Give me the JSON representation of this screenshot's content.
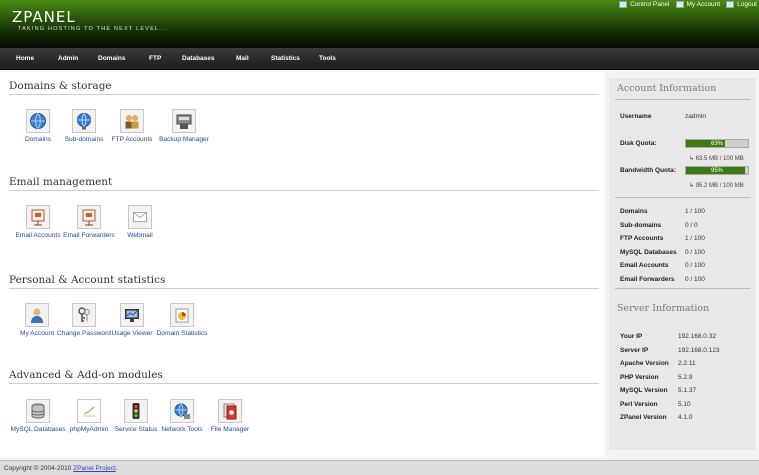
{
  "header": {
    "logo": "ZPANEL",
    "tagline": "TAKING HOSTING TO THE NEXT LEVEL...",
    "links": [
      {
        "label": "Control Panel",
        "icon": "control-panel-icon"
      },
      {
        "label": "My Account",
        "icon": "account-icon"
      },
      {
        "label": "Logout",
        "icon": "logout-icon"
      }
    ]
  },
  "nav": {
    "items": [
      "Home",
      "Admin",
      "Domains",
      "FTP",
      "Databases",
      "Mail",
      "Statistics",
      "Tools"
    ]
  },
  "sections": [
    {
      "title": "Domains & storage",
      "modules": [
        {
          "label": "Domains",
          "icon": "globe-icon"
        },
        {
          "label": "Sub-domains",
          "icon": "globe-icon"
        },
        {
          "label": "FTP Accounts",
          "icon": "users-icon"
        },
        {
          "label": "Backup Manager",
          "icon": "backup-icon"
        }
      ]
    },
    {
      "title": "Email management",
      "modules": [
        {
          "label": "Email Accounts",
          "icon": "email-board-icon"
        },
        {
          "label": "Email Forwarders",
          "icon": "email-board-icon"
        },
        {
          "label": "Webmail",
          "icon": "webmail-icon"
        }
      ]
    },
    {
      "title": "Personal & Account statistics",
      "modules": [
        {
          "label": "My Account",
          "icon": "user-icon"
        },
        {
          "label": "Change Password",
          "icon": "keys-icon"
        },
        {
          "label": "Usage Viewer",
          "icon": "usage-icon"
        },
        {
          "label": "Domain Statistics",
          "icon": "statistics-icon"
        }
      ]
    },
    {
      "title": "Advanced & Add-on modules",
      "modules": [
        {
          "label": "MySQL Databases",
          "icon": "database-icon"
        },
        {
          "label": "phpMyAdmin",
          "icon": "phpmyadmin-icon"
        },
        {
          "label": "Service Status",
          "icon": "traffic-light-icon"
        },
        {
          "label": "Network Tools",
          "icon": "network-icon"
        },
        {
          "label": "File Manager",
          "icon": "file-manager-icon"
        }
      ]
    }
  ],
  "account_info": {
    "title": "Account Information",
    "username_label": "Username",
    "username": "zadmin",
    "disk_label": "Disk Quota:",
    "disk_percent": 63,
    "disk_percent_text": "63%",
    "disk_detail": "↳ 63.5 MB / 100 MB",
    "bandwidth_label": "Bandwidth Quota:",
    "bandwidth_percent": 95,
    "bandwidth_percent_text": "95%",
    "bandwidth_detail": "↳ 95.2 MB / 100 MB",
    "stats": [
      {
        "label": "Domains",
        "value": "1 / 100"
      },
      {
        "label": "Sub-domains",
        "value": "0 / 0"
      },
      {
        "label": "FTP Accounts",
        "value": "1 / 100"
      },
      {
        "label": "MySQL Databases",
        "value": "0 / 100"
      },
      {
        "label": "Email Accounts",
        "value": "0 / 100"
      },
      {
        "label": "Email Forwarders",
        "value": "0 / 100"
      }
    ]
  },
  "server_info": {
    "title": "Server Information",
    "rows": [
      {
        "label": "Your IP",
        "value": "192.168.0.32"
      },
      {
        "label": "Server IP",
        "value": "192.168.0.123"
      },
      {
        "label": "Apache Version",
        "value": "2.2.11"
      },
      {
        "label": "PHP Version",
        "value": "5.2.9"
      },
      {
        "label": "MySQL Version",
        "value": "5.1.37"
      },
      {
        "label": "Perl Version",
        "value": "5.10"
      },
      {
        "label": "ZPanel Version",
        "value": "4.1.0"
      }
    ]
  },
  "footer": {
    "text": "Copyright © 2004-2010 ",
    "link": "ZPanel Project",
    "suffix": "."
  },
  "colors": {
    "header_green": "#2c5a0a",
    "bar_green": "#3d7a12",
    "link_blue": "#224a99"
  }
}
